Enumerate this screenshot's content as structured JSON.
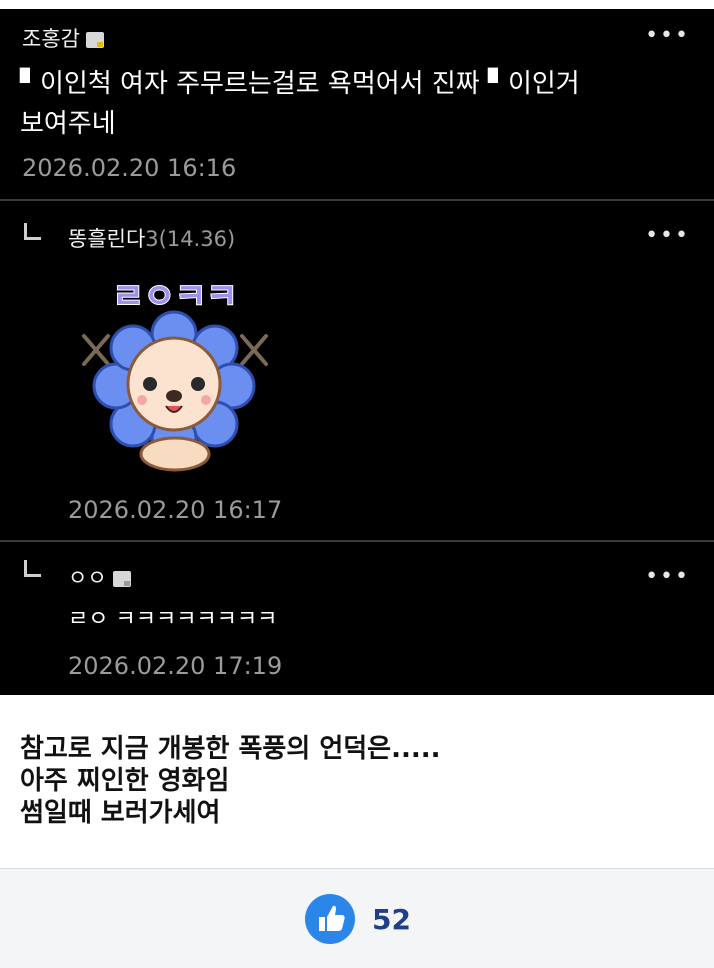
{
  "comments": [
    {
      "nickname": "조홍감",
      "text_line1": "▘이인척 여자 주무르는걸로 욕먹어서 진짜 ▘이인거",
      "text_line2": "보여주네",
      "date": "2026.02.20 16:16",
      "more": "•••"
    },
    {
      "nickname": "똥흘린다",
      "score": "3(14.36)",
      "sticker_text": "ㄹㅇㅋㅋ",
      "date": "2026.02.20 16:17",
      "more": "•••"
    },
    {
      "nickname": "ㅇㅇ",
      "text": "ㄹㅇ ㅋㅋㅋㅋㅋㅋㅋㅋ",
      "date": "2026.02.20 17:19",
      "more": "•••"
    }
  ],
  "post": {
    "line1": "참고로 지금 개봉한 폭풍의 언덕은.....",
    "line2": "아주 찌인한 영화임",
    "line3": "썸일때 보러가세여"
  },
  "footer": {
    "like_count": "52"
  },
  "colors": {
    "comment_bg": "#000000",
    "date": "#9b9b9b",
    "like_blue": "#2a86e8",
    "like_count": "#1f3f8a"
  },
  "icons": [
    "thumbs-up-icon",
    "reply-arrow-icon",
    "more-icon",
    "member-badge-icon"
  ]
}
